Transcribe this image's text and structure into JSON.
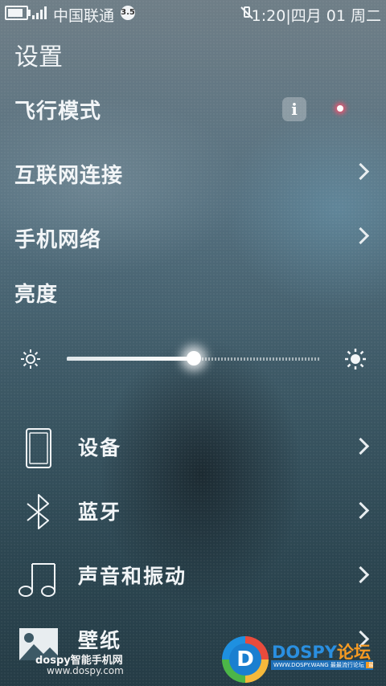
{
  "status_bar": {
    "carrier": "中国联通",
    "network_badge": "3.5",
    "datetime": "1:20|四月 01 周二",
    "icons": [
      "battery-icon",
      "signal-icon",
      "network-badge",
      "vibrate-mute-icon"
    ]
  },
  "page_title": "设置",
  "rows": {
    "airplane_mode": "飞行模式",
    "info_icon": "i",
    "internet": "互联网连接",
    "mobile_network": "手机网络",
    "brightness": "亮度"
  },
  "brightness": {
    "level": 0.5
  },
  "items": [
    {
      "label": "设备",
      "icon": "phone-icon"
    },
    {
      "label": "蓝牙",
      "icon": "bluetooth-icon"
    },
    {
      "label": "声音和振动",
      "icon": "music-note-icon"
    },
    {
      "label": "壁纸",
      "icon": "image-icon"
    }
  ],
  "watermark": {
    "left_line1": "dospy智能手机网",
    "left_line2": "www.dospy.com",
    "brand_en": "DOSPY",
    "brand_cn": "论坛",
    "strip_text": "WWW.DOSPY.WANG 最最流行论坛",
    "strip_tag": "最新最热帖"
  },
  "colors": {
    "text": "#f2f5f7",
    "toggle_glow": "#ff506e",
    "brand_blue": "#2a8fe0",
    "brand_orange": "#f59a23"
  }
}
